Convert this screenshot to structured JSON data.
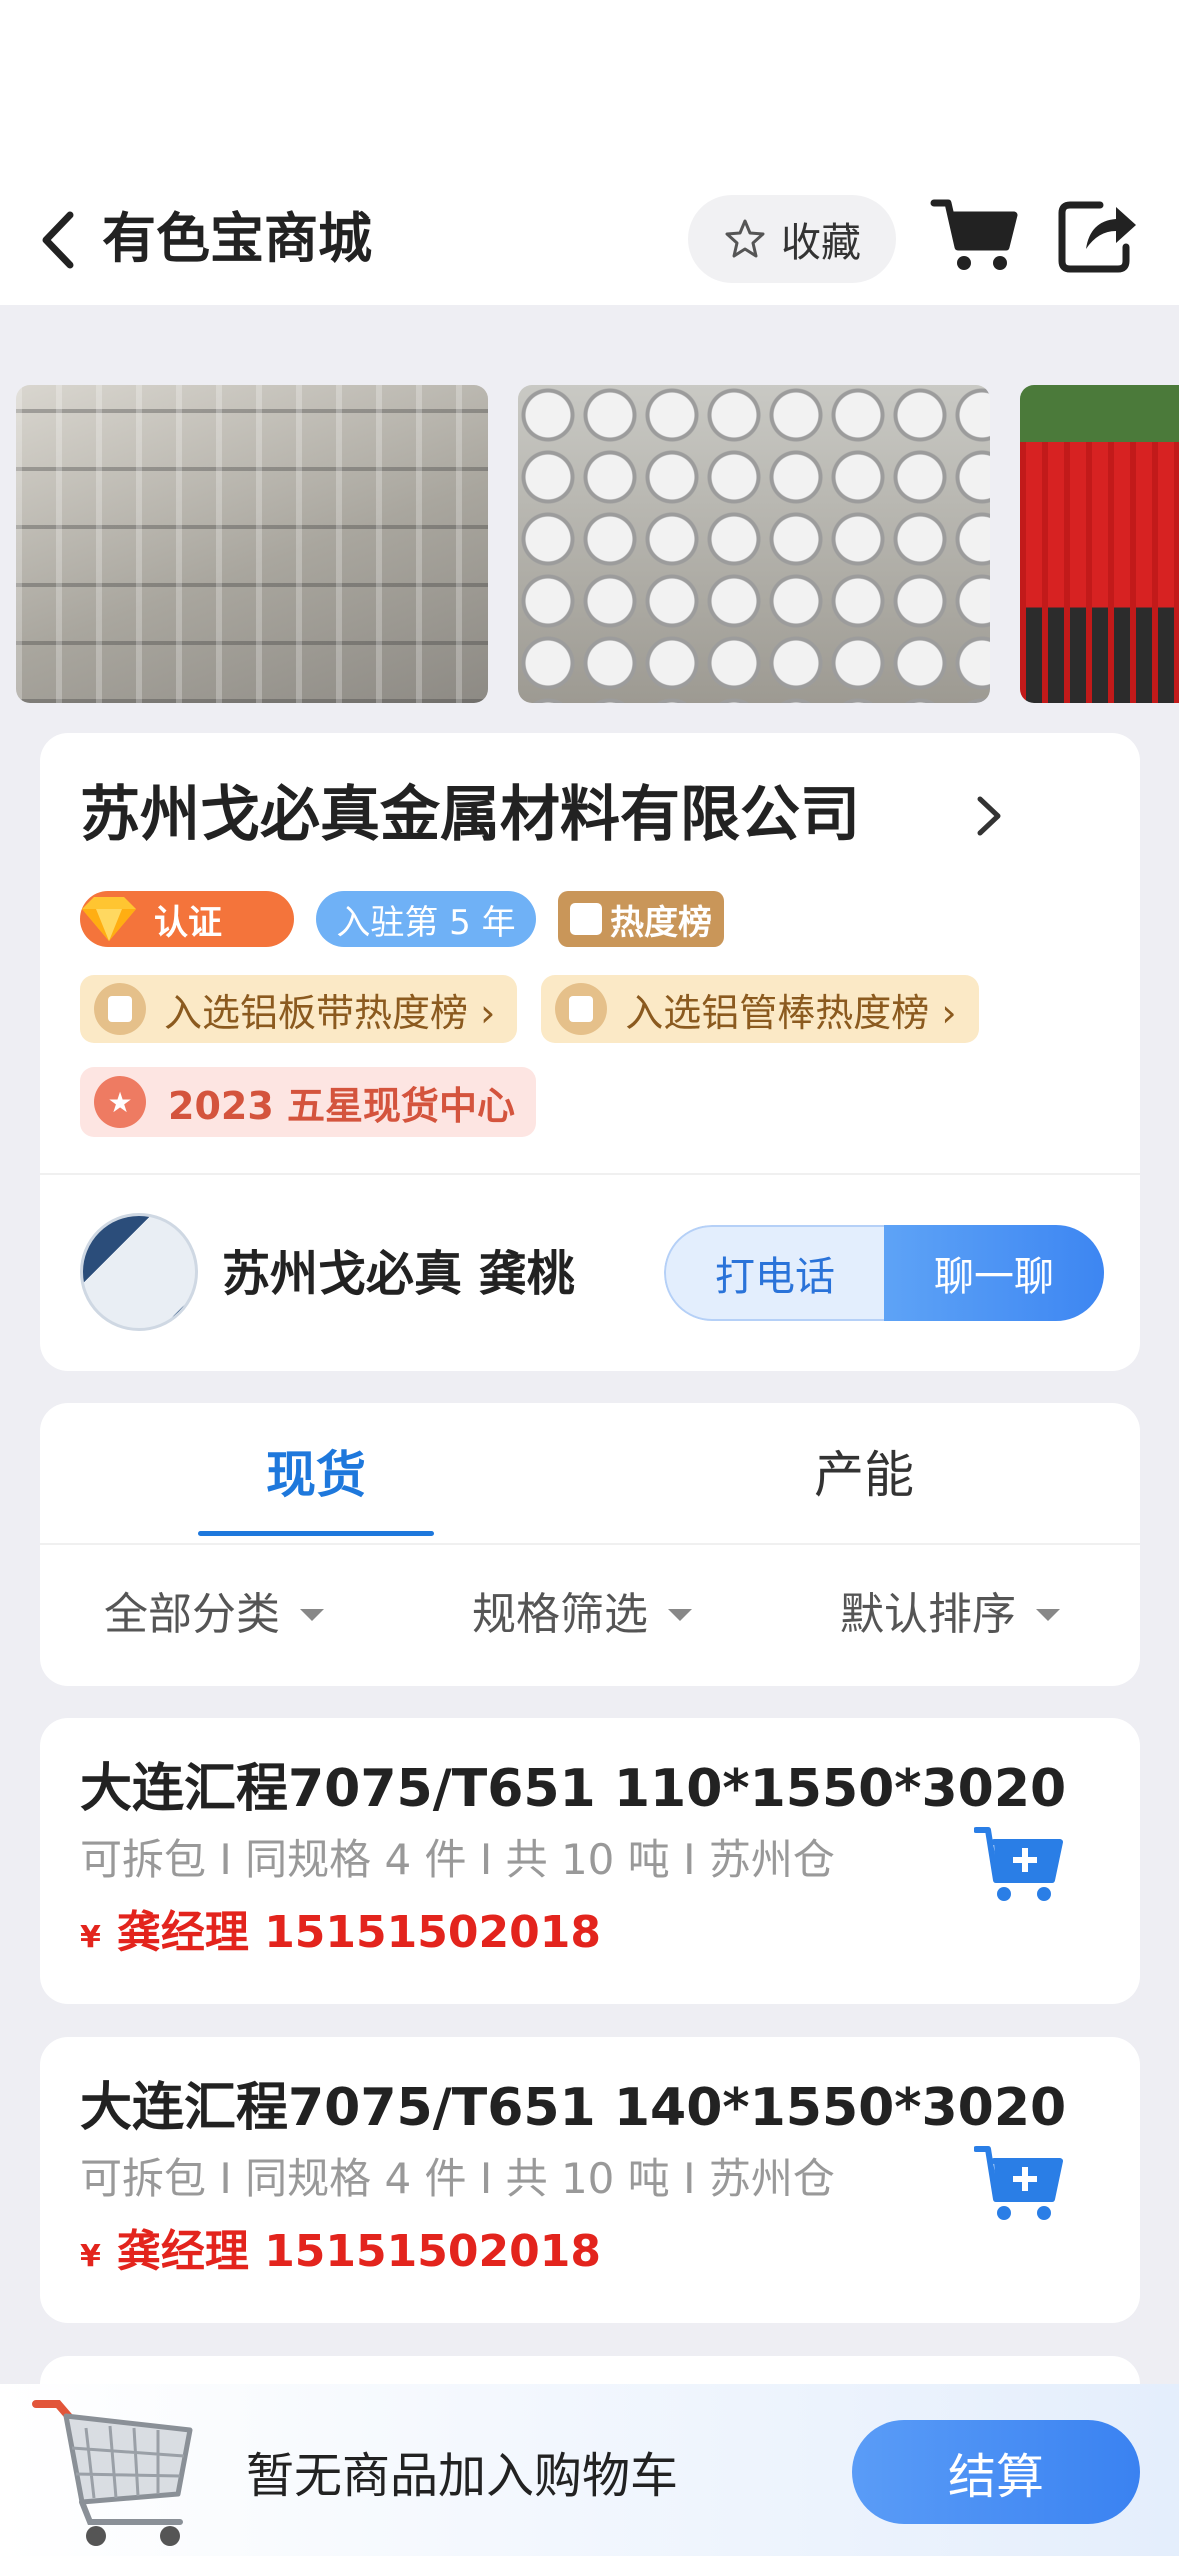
{
  "header": {
    "title": "有色宝商城",
    "favorite_label": "收藏"
  },
  "company": {
    "name": "苏州戈必真金属材料有限公司",
    "badges": {
      "certified": "认证",
      "years": "入驻第 5 年",
      "hot_list": "热度榜"
    },
    "rankings": [
      {
        "label": "入选铝板带热度榜 ›"
      },
      {
        "label": "入选铝管棒热度榜 ›"
      }
    ],
    "star_award": "2023 五星现货中心",
    "contact_name": "苏州戈必真 龚桃",
    "call_label": "打电话",
    "chat_label": "聊一聊"
  },
  "tabs": {
    "stock": "现货",
    "capacity": "产能"
  },
  "filters": {
    "all_categories": "全部分类",
    "spec_filter": "规格筛选",
    "default_sort": "默认排序"
  },
  "products": [
    {
      "title": "大连汇程7075/T651 110*1550*3020",
      "meta": "可拆包 I 同规格 4 件 I 共 10 吨 I 苏州仓",
      "yen": "¥",
      "contact": "龚经理 15151502018"
    },
    {
      "title": "大连汇程7075/T651 140*1550*3020",
      "meta": "可拆包 I 同规格 4 件 I 共 10 吨 I 苏州仓",
      "yen": "¥",
      "contact": "龚经理 15151502018"
    }
  ],
  "bottom_bar": {
    "empty_cart_text": "暂无商品加入购物车",
    "checkout_label": "结算"
  },
  "colors": {
    "accent_blue": "#1e78dc",
    "price_red": "#e3241d",
    "cert_orange": "#f4743b",
    "hot_gold": "#c99659"
  }
}
